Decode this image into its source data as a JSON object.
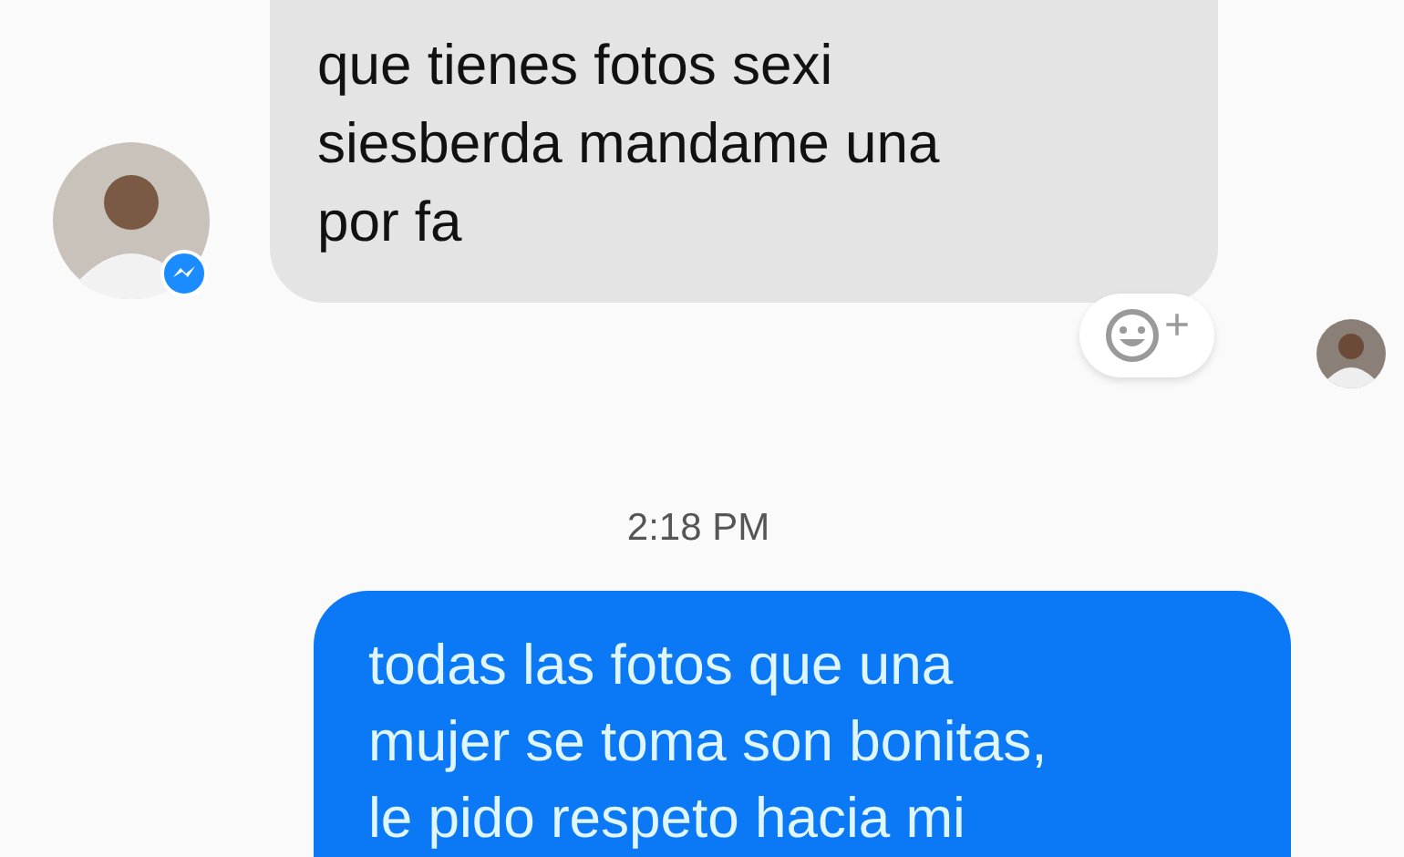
{
  "messages": [
    {
      "kind": "incoming",
      "text": "que tienes fotos sexi\nsiesberda mandame una\npor fa",
      "seen": true
    },
    {
      "kind": "time",
      "text": "2:18 PM"
    },
    {
      "kind": "outgoing",
      "text": "todas las fotos que una\nmujer se toma son bonitas,\nle pido respeto hacia mi"
    }
  ],
  "reaction_button": {
    "label": "+"
  }
}
